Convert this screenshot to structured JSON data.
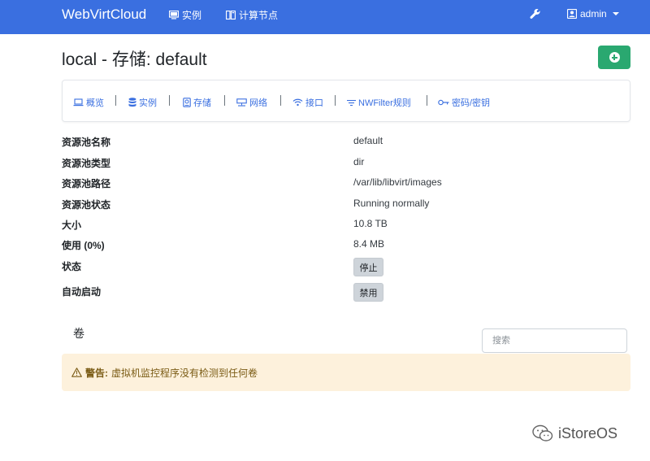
{
  "navbar": {
    "brand": "WebVirtCloud",
    "instances_label": "实例",
    "nodes_label": "计算节点",
    "user_label": "admin",
    "accent_color": "#3a6fe0"
  },
  "page": {
    "title": "local - 存储: default"
  },
  "tabs": [
    {
      "label": "概览",
      "icon": "laptop-icon"
    },
    {
      "label": "实例",
      "icon": "database-icon"
    },
    {
      "label": "存储",
      "icon": "hdd-icon"
    },
    {
      "label": "网络",
      "icon": "network-icon"
    },
    {
      "label": "接口",
      "icon": "wifi-icon"
    },
    {
      "label": "NWFilter规则",
      "icon": "filter-icon"
    },
    {
      "label": "密码/密钥",
      "icon": "key-icon"
    }
  ],
  "details": {
    "name_label": "资源池名称",
    "name_value": "default",
    "type_label": "资源池类型",
    "type_value": "dir",
    "path_label": "资源池路径",
    "path_value": "/var/lib/libvirt/images",
    "status_label": "资源池状态",
    "status_value": "Running normally",
    "size_label": "大小",
    "size_value": "10.8 TB",
    "usage_label": "使用 (0%)",
    "usage_value": "8.4 MB",
    "state_label": "状态",
    "state_button": "停止",
    "autostart_label": "自动启动",
    "autostart_button": "禁用"
  },
  "volumes": {
    "title": "卷",
    "search_placeholder": "搜索",
    "warning_strong": "警告:",
    "warning_text": "虚拟机监控程序没有检测到任何卷"
  },
  "watermark": {
    "text": "iStoreOS"
  }
}
